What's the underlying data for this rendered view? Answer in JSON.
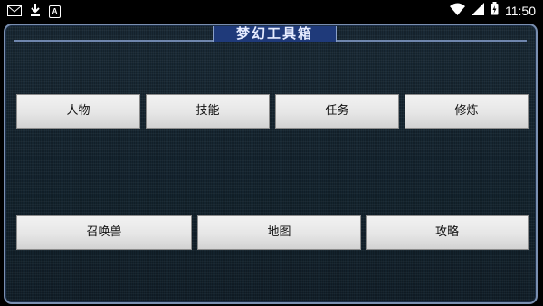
{
  "status_bar": {
    "time": "11:50",
    "left_icons": [
      "mail-icon",
      "download-icon",
      "font-a-icon"
    ],
    "right_icons": [
      "wifi-icon",
      "signal-icon",
      "battery-icon"
    ],
    "a_glyph": "A"
  },
  "window": {
    "title": "梦幻工具箱",
    "accent_color": "#1f3a7a"
  },
  "buttons_row1": [
    {
      "label": "人物"
    },
    {
      "label": "技能"
    },
    {
      "label": "任务"
    },
    {
      "label": "修炼"
    }
  ],
  "buttons_row2": [
    {
      "label": "召唤兽"
    },
    {
      "label": "地图"
    },
    {
      "label": "攻略"
    }
  ]
}
